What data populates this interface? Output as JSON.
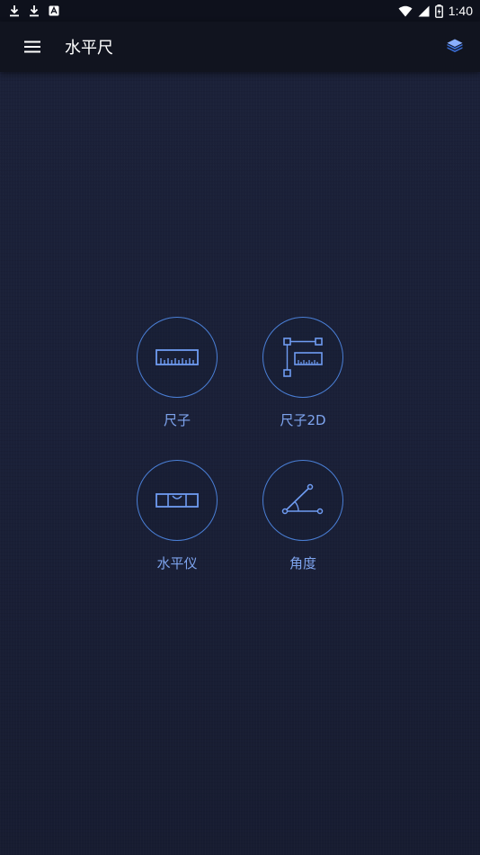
{
  "status_bar": {
    "time": "1:40",
    "left_icons": [
      "download-icon",
      "download-icon",
      "app-notification-icon"
    ],
    "right_icons": [
      "wifi-icon",
      "signal-icon",
      "battery-icon"
    ]
  },
  "app_bar": {
    "title": "水平尺",
    "menu_icon": "hamburger-menu-icon",
    "action_icon": "layers-icon"
  },
  "tools": [
    {
      "label": "尺子",
      "icon": "ruler-icon"
    },
    {
      "label": "尺子2D",
      "icon": "ruler-2d-icon"
    },
    {
      "label": "水平仪",
      "icon": "spirit-level-icon"
    },
    {
      "label": "角度",
      "icon": "protractor-angle-icon"
    }
  ],
  "colors": {
    "background": "#1a2038",
    "app_bar": "#11141f",
    "accent": "#4a7fd6",
    "label": "#7ea4ee"
  }
}
